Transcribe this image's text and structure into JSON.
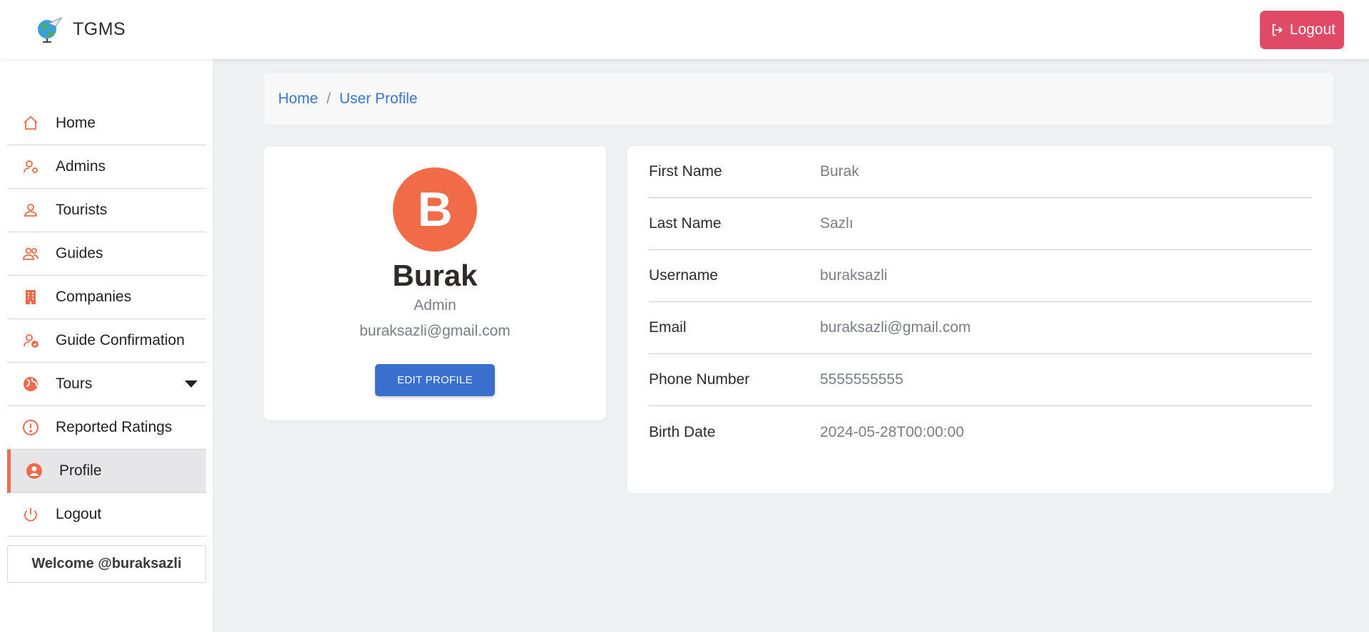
{
  "app": {
    "brand": "TGMS",
    "logout_label": "Logout"
  },
  "sidebar": {
    "items": [
      {
        "label": "Home",
        "icon": "home-icon"
      },
      {
        "label": "Admins",
        "icon": "user-gear-icon"
      },
      {
        "label": "Tourists",
        "icon": "user-icon"
      },
      {
        "label": "Guides",
        "icon": "users-icon"
      },
      {
        "label": "Companies",
        "icon": "building-icon"
      },
      {
        "label": "Guide Confirmation",
        "icon": "user-check-icon"
      },
      {
        "label": "Tours",
        "icon": "globe-icon"
      },
      {
        "label": "Reported Ratings",
        "icon": "alert-icon"
      },
      {
        "label": "Profile",
        "icon": "user-circle-icon",
        "active": true
      },
      {
        "label": "Logout",
        "icon": "power-icon"
      }
    ],
    "welcome": "Welcome @buraksazli"
  },
  "breadcrumb": {
    "home": "Home",
    "separator": "/",
    "current": "User Profile"
  },
  "profile": {
    "initial": "B",
    "name": "Burak",
    "role": "Admin",
    "email": "buraksazli@gmail.com",
    "edit_label": "EDIT PROFILE"
  },
  "details": [
    {
      "label": "First Name",
      "value": "Burak"
    },
    {
      "label": "Last Name",
      "value": "Sazlı"
    },
    {
      "label": "Username",
      "value": "buraksazli"
    },
    {
      "label": "Email",
      "value": "buraksazli@gmail.com"
    },
    {
      "label": "Phone Number",
      "value": "5555555555"
    },
    {
      "label": "Birth Date",
      "value": "2024-05-28T00:00:00"
    }
  ],
  "colors": {
    "accent": "#f06a4b",
    "primary": "#3a6fce",
    "danger": "#e04a66"
  }
}
